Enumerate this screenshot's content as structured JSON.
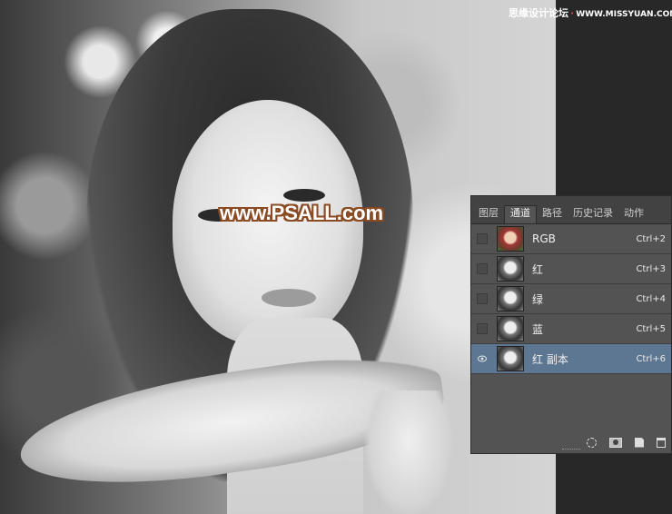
{
  "site": {
    "name": "思缘设计论坛",
    "url": "WWW.MISSYUAN.COM"
  },
  "watermark": "www.PSALL.com",
  "panel": {
    "tabs": [
      "图层",
      "通道",
      "路径",
      "历史记录",
      "动作"
    ],
    "active_tab": "通道",
    "channels": [
      {
        "name": "RGB",
        "shortcut": "Ctrl+2",
        "thumb": "color",
        "visible": false,
        "selected": false
      },
      {
        "name": "红",
        "shortcut": "Ctrl+3",
        "thumb": "gray",
        "visible": false,
        "selected": false
      },
      {
        "name": "绿",
        "shortcut": "Ctrl+4",
        "thumb": "gray",
        "visible": false,
        "selected": false
      },
      {
        "name": "蓝",
        "shortcut": "Ctrl+5",
        "thumb": "gray",
        "visible": false,
        "selected": false
      },
      {
        "name": "红 副本",
        "shortcut": "Ctrl+6",
        "thumb": "gray",
        "visible": true,
        "selected": true
      }
    ],
    "footer_icons": [
      "load-channel-as-selection-icon",
      "save-selection-as-channel-icon",
      "new-channel-icon",
      "delete-channel-icon"
    ],
    "selected_color": "#5d7692"
  }
}
